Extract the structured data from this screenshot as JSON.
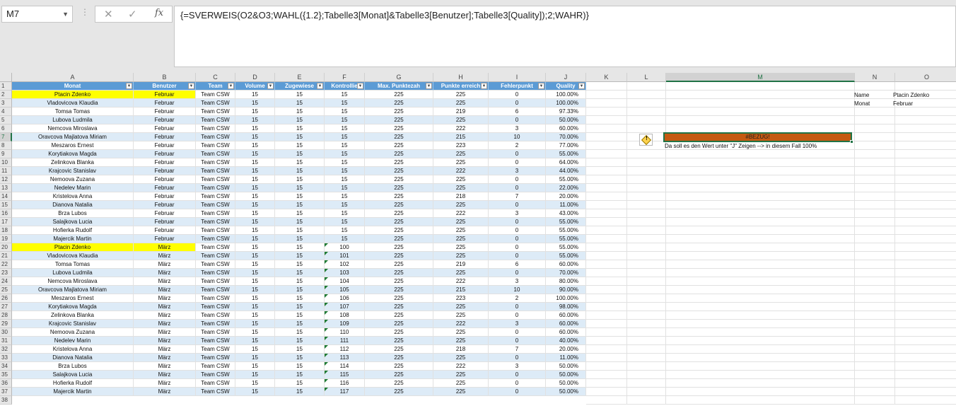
{
  "formula_bar": {
    "name_box": "M7",
    "formula": "{=SVERWEIS(O2&O3;WAHL({1.2};Tabelle3[Monat]&Tabelle3[Benutzer];Tabelle3[Quality]);2;WAHR)}",
    "fx_label": "fx"
  },
  "columns": [
    "A",
    "B",
    "C",
    "D",
    "E",
    "F",
    "G",
    "H",
    "I",
    "J",
    "K",
    "L",
    "M",
    "N",
    "O"
  ],
  "selected_column": "M",
  "selected_row": 7,
  "table": {
    "headers": [
      "Monat",
      "Benutzer",
      "Team",
      "Volume",
      "Zugewiese",
      "Kontrollie",
      "Max. Punktezah",
      "Punkte erreich",
      "Fehlerpunkt",
      "Quality"
    ],
    "rows": [
      [
        "Ptacin Zdenko",
        "Februar",
        "Team CSW",
        "15",
        "15",
        "15",
        "225",
        "225",
        "0",
        "100.00%"
      ],
      [
        "Vladovicova Klaudia",
        "Februar",
        "Team CSW",
        "15",
        "15",
        "15",
        "225",
        "225",
        "0",
        "100.00%"
      ],
      [
        "Tomsa Tomas",
        "Februar",
        "Team CSW",
        "15",
        "15",
        "15",
        "225",
        "219",
        "6",
        "97.33%"
      ],
      [
        "Lubova Ludmila",
        "Februar",
        "Team CSW",
        "15",
        "15",
        "15",
        "225",
        "225",
        "0",
        "50.00%"
      ],
      [
        "Nemcova Miroslava",
        "Februar",
        "Team CSW",
        "15",
        "15",
        "15",
        "225",
        "222",
        "3",
        "60.00%"
      ],
      [
        "Oravcova Majlatova Miriam",
        "Februar",
        "Team CSW",
        "15",
        "15",
        "15",
        "225",
        "215",
        "10",
        "70.00%"
      ],
      [
        "Meszaros Ernest",
        "Februar",
        "Team CSW",
        "15",
        "15",
        "15",
        "225",
        "223",
        "2",
        "77.00%"
      ],
      [
        "Korytiakova  Magda",
        "Februar",
        "Team CSW",
        "15",
        "15",
        "15",
        "225",
        "225",
        "0",
        "55.00%"
      ],
      [
        "Zelinkova Blanka",
        "Februar",
        "Team CSW",
        "15",
        "15",
        "15",
        "225",
        "225",
        "0",
        "64.00%"
      ],
      [
        "Krajcovic Stanislav",
        "Februar",
        "Team CSW",
        "15",
        "15",
        "15",
        "225",
        "222",
        "3",
        "44.00%"
      ],
      [
        "Nemoova Zuzana",
        "Februar",
        "Team CSW",
        "15",
        "15",
        "15",
        "225",
        "225",
        "0",
        "55.00%"
      ],
      [
        "Nedelev Marin",
        "Februar",
        "Team CSW",
        "15",
        "15",
        "15",
        "225",
        "225",
        "0",
        "22.00%"
      ],
      [
        "Kristelova Anna",
        "Februar",
        "Team CSW",
        "15",
        "15",
        "15",
        "225",
        "218",
        "7",
        "20.00%"
      ],
      [
        "Dianova Natalia",
        "Februar",
        "Team CSW",
        "15",
        "15",
        "15",
        "225",
        "225",
        "0",
        "11.00%"
      ],
      [
        "Brza Lubos",
        "Februar",
        "Team CSW",
        "15",
        "15",
        "15",
        "225",
        "222",
        "3",
        "43.00%"
      ],
      [
        "Salajkova Lucia",
        "Februar",
        "Team CSW",
        "15",
        "15",
        "15",
        "225",
        "225",
        "0",
        "55.00%"
      ],
      [
        "Hofierka Rudolf",
        "Februar",
        "Team CSW",
        "15",
        "15",
        "15",
        "225",
        "225",
        "0",
        "55.00%"
      ],
      [
        "Majercik Martin",
        "Februar",
        "Team CSW",
        "15",
        "15",
        "15",
        "225",
        "225",
        "0",
        "55.00%"
      ],
      [
        "Ptacin Zdenko",
        "März",
        "Team CSW",
        "15",
        "15",
        "100",
        "225",
        "225",
        "0",
        "55.00%"
      ],
      [
        "Vladovicova Klaudia",
        "März",
        "Team CSW",
        "15",
        "15",
        "101",
        "225",
        "225",
        "0",
        "55.00%"
      ],
      [
        "Tomsa Tomas",
        "März",
        "Team CSW",
        "15",
        "15",
        "102",
        "225",
        "219",
        "6",
        "60.00%"
      ],
      [
        "Lubova Ludmila",
        "März",
        "Team CSW",
        "15",
        "15",
        "103",
        "225",
        "225",
        "0",
        "70.00%"
      ],
      [
        "Nemcova Miroslava",
        "März",
        "Team CSW",
        "15",
        "15",
        "104",
        "225",
        "222",
        "3",
        "80.00%"
      ],
      [
        "Oravcova Majlatova Miriam",
        "März",
        "Team CSW",
        "15",
        "15",
        "105",
        "225",
        "215",
        "10",
        "90.00%"
      ],
      [
        "Meszaros Ernest",
        "März",
        "Team CSW",
        "15",
        "15",
        "106",
        "225",
        "223",
        "2",
        "100.00%"
      ],
      [
        "Korytiakova  Magda",
        "März",
        "Team CSW",
        "15",
        "15",
        "107",
        "225",
        "225",
        "0",
        "98.00%"
      ],
      [
        "Zelinkova Blanka",
        "März",
        "Team CSW",
        "15",
        "15",
        "108",
        "225",
        "225",
        "0",
        "60.00%"
      ],
      [
        "Krajcovic Stanislav",
        "März",
        "Team CSW",
        "15",
        "15",
        "109",
        "225",
        "222",
        "3",
        "60.00%"
      ],
      [
        "Nemoova Zuzana",
        "März",
        "Team CSW",
        "15",
        "15",
        "110",
        "225",
        "225",
        "0",
        "60.00%"
      ],
      [
        "Nedelev Marin",
        "März",
        "Team CSW",
        "15",
        "15",
        "111",
        "225",
        "225",
        "0",
        "40.00%"
      ],
      [
        "Kristelova Anna",
        "März",
        "Team CSW",
        "15",
        "15",
        "112",
        "225",
        "218",
        "7",
        "20.00%"
      ],
      [
        "Dianova Natalia",
        "März",
        "Team CSW",
        "15",
        "15",
        "113",
        "225",
        "225",
        "0",
        "11.00%"
      ],
      [
        "Brza Lubos",
        "März",
        "Team CSW",
        "15",
        "15",
        "114",
        "225",
        "222",
        "3",
        "50.00%"
      ],
      [
        "Salajkova Lucia",
        "März",
        "Team CSW",
        "15",
        "15",
        "115",
        "225",
        "225",
        "0",
        "50.00%"
      ],
      [
        "Hofierka Rudolf",
        "März",
        "Team CSW",
        "15",
        "15",
        "116",
        "225",
        "225",
        "0",
        "50.00%"
      ],
      [
        "Majercik Martin",
        "März",
        "Team CSW",
        "15",
        "15",
        "117",
        "225",
        "225",
        "0",
        "50.00%"
      ]
    ],
    "highlighted_rows": [
      2,
      20
    ]
  },
  "lookup": {
    "name_label": "Name",
    "name_value": "Ptacin Zdenko",
    "month_label": "Monat",
    "month_value": "Februar",
    "result": "#BEZUG!",
    "note": "Da soll es den Wert unter \"J\" Zeigen --> in diesem Fall 100%"
  },
  "colors": {
    "header_blue": "#5b9bd5",
    "band_blue": "#ddebf7",
    "highlight_yellow": "#ffff00",
    "error_fill": "#c55a11",
    "selection_green": "#217346"
  },
  "icons": {
    "warning": "warning-diamond-icon",
    "cancel": "cancel-x-icon",
    "enter": "enter-check-icon"
  }
}
